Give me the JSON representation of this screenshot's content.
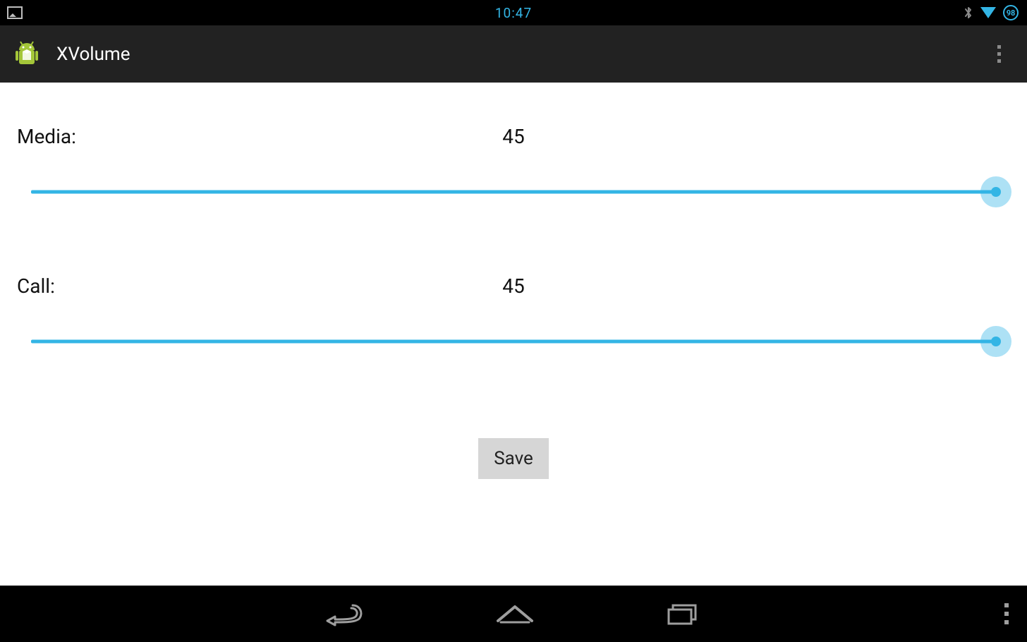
{
  "status": {
    "time": "10:47",
    "battery": "98"
  },
  "actionbar": {
    "title": "XVolume"
  },
  "sliders": {
    "media": {
      "label": "Media:",
      "value": "45"
    },
    "call": {
      "label": "Call:",
      "value": "45"
    }
  },
  "buttons": {
    "save": "Save"
  }
}
